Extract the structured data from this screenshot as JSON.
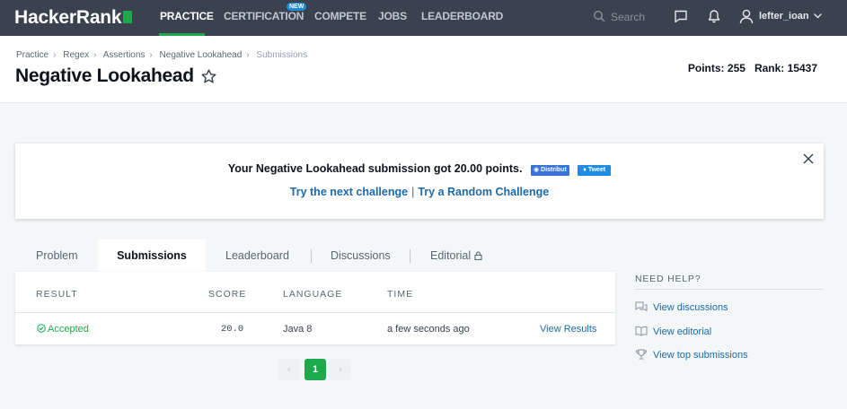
{
  "nav": {
    "logo": "HackerRank",
    "items": [
      "PRACTICE",
      "CERTIFICATION",
      "COMPETE",
      "JOBS",
      "LEADERBOARD"
    ],
    "new_badge": "NEW",
    "search_placeholder": "Search",
    "username": "lefter_ioan"
  },
  "breadcrumb": [
    "Practice",
    "Regex",
    "Assertions",
    "Negative Lookahead",
    "Submissions"
  ],
  "title": "Negative Lookahead",
  "stats": {
    "points_label": "Points:",
    "points_value": "255",
    "rank_label": "Rank:",
    "rank_value": "15437"
  },
  "banner": {
    "message": "Your Negative Lookahead submission got 20.00 points.",
    "fb_label": "Distribut",
    "tweet_label": "Tweet",
    "link_next": "Try the next challenge",
    "separator": "|",
    "link_random": "Try a Random Challenge"
  },
  "tabs": [
    "Problem",
    "Submissions",
    "Leaderboard",
    "Discussions",
    "Editorial"
  ],
  "table": {
    "headers": [
      "RESULT",
      "SCORE",
      "LANGUAGE",
      "TIME"
    ],
    "rows": [
      {
        "result": "Accepted",
        "score": "20.0",
        "language": "Java 8",
        "time": "a few seconds ago",
        "action": "View Results"
      }
    ]
  },
  "pagination": {
    "prev": "‹",
    "current": "1",
    "next": "›"
  },
  "help": {
    "title": "NEED HELP?",
    "links": [
      "View discussions",
      "View editorial",
      "View top submissions"
    ]
  },
  "colors": {
    "accent": "#1ba94c",
    "nav_bg": "#39424e",
    "link": "#1c6aa8"
  }
}
